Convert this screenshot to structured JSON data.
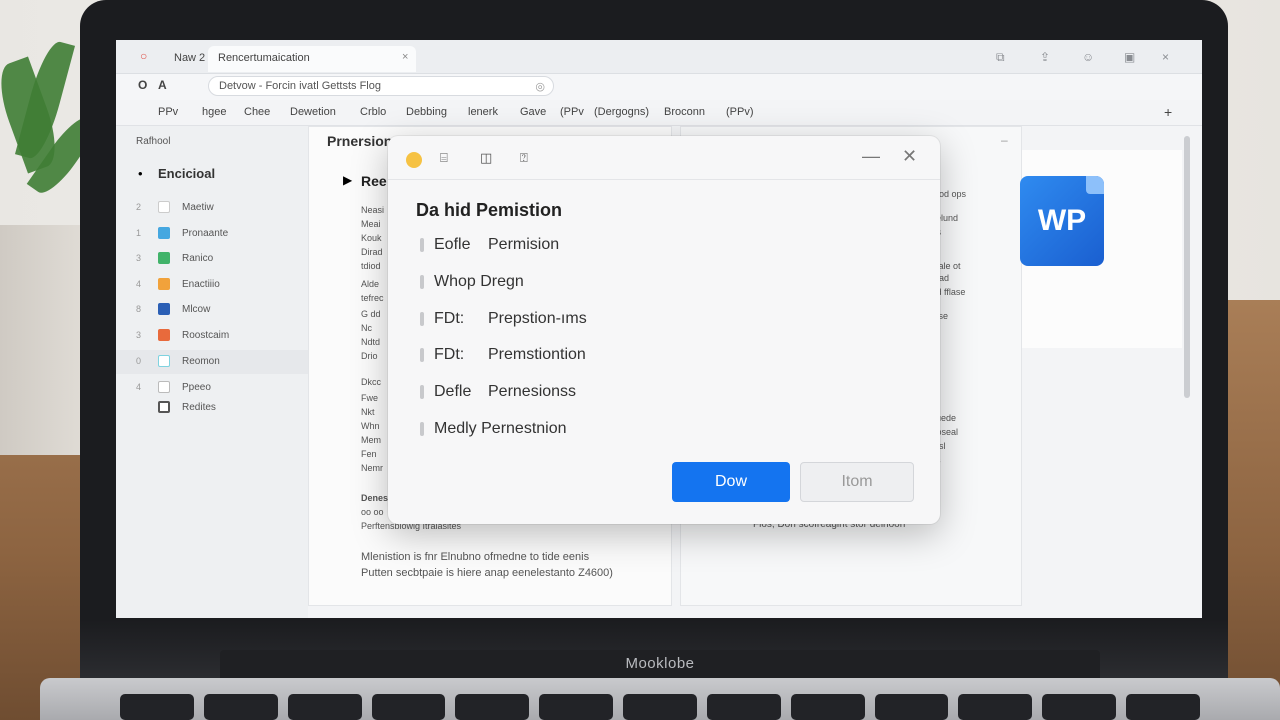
{
  "browser": {
    "tabs": [
      {
        "label": "Naw 2"
      },
      {
        "label": "Rencertumaication"
      }
    ],
    "tab_close": "×",
    "window_controls": [
      "⧉",
      "⇪",
      "☺",
      "▣",
      "×"
    ],
    "nav": [
      "O",
      "A"
    ],
    "url": "Detvow - Forcin ivatl Gettsts Flog",
    "menu": [
      "PPv",
      "hgee",
      "Chee",
      "Dewetion",
      "Crblo",
      "Debbing",
      "lenerk",
      "Gave",
      "(PPv",
      "(Dergogns)",
      "Broconn",
      "(PPv)"
    ],
    "menu_right": "+"
  },
  "sidebar": {
    "header": "Rafhool",
    "section": "Encicioal",
    "items": [
      {
        "num": "2",
        "label": "Maetiw",
        "color": "#ffffff"
      },
      {
        "num": "1",
        "label": "Pronaante",
        "color": "#45a7e0"
      },
      {
        "num": "3",
        "label": "Ranico",
        "color": "#41b36a"
      },
      {
        "num": "4",
        "label": "Enactiiio",
        "color": "#f1a23b"
      },
      {
        "num": "8",
        "label": "Mlcow",
        "color": "#2b5fb5"
      },
      {
        "num": "3",
        "label": "Roostcaim",
        "color": "#e86a3c"
      },
      {
        "num": "0",
        "label": "Reomon",
        "color": "#7fd3e0"
      },
      {
        "num": "4",
        "label": "Ppeeo",
        "color": "#ffffff"
      },
      {
        "num": "",
        "label": "Redites",
        "color": "#555555"
      }
    ]
  },
  "document": {
    "title": "Prnersion",
    "subtitle": "Ree",
    "lines": [
      "Neasi",
      "Meai",
      "Kouk",
      "Dirad",
      "tdiod",
      "Alde",
      "tefrec",
      "G dd",
      "Nc",
      "Ndtd",
      "Drio",
      "Dkcc",
      "Fwe",
      "Nkt",
      "Whn",
      "Mem",
      "Fen",
      "Nemr",
      "Denes",
      "oo oo",
      "Perftensblowig Itraiasltes",
      "Mlenistion is fnr Elnubno ofmedne to tide eenis",
      "Putten secbtpaie is hiere anap eenelestanto Z4600)"
    ]
  },
  "right_panel": {
    "lines": [
      "ottod ops",
      "Gelund",
      "tds",
      "letale ot",
      "ddad",
      "tnd fflase",
      "cdse",
      "tsuede",
      "moseal",
      "edsl",
      "dis"
    ],
    "footer": "Flos, Don scofreagint stor deinoon",
    "app_icon_label": "WP",
    "minimize": "–"
  },
  "dialog": {
    "title": "Da hid Pemistion",
    "minimize": "—",
    "close": "✕",
    "tools": [
      "⌸",
      "◫",
      "⍰"
    ],
    "rows": [
      {
        "a": "Eofle",
        "b": "Permision"
      },
      {
        "a": "Whop Dregn",
        "b": ""
      },
      {
        "a": "FDt:",
        "b": "Prepstion-ıms"
      },
      {
        "a": "FDt:",
        "b": "Premstiontion"
      },
      {
        "a": "Defle",
        "b": "Pernesionss"
      },
      {
        "a": "Medly Pernestnion",
        "b": ""
      }
    ],
    "primary_button": "Dow",
    "secondary_button": "Itom"
  },
  "device": {
    "brand": "Mooklobe"
  }
}
